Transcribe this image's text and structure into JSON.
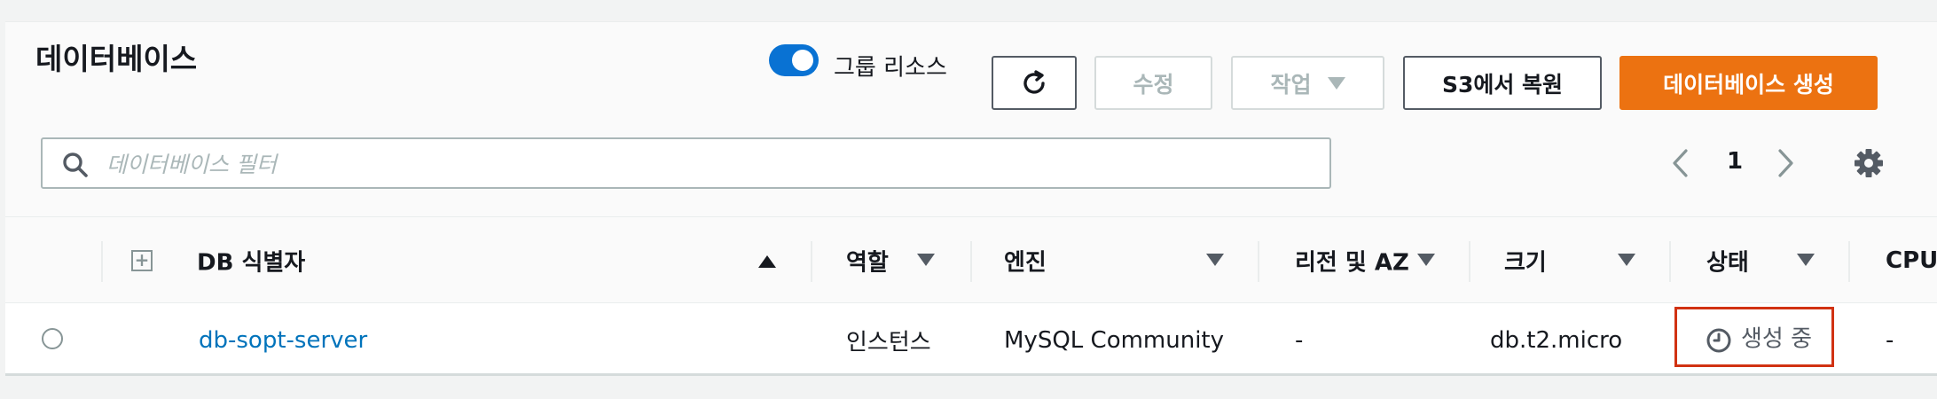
{
  "header": {
    "title": "데이터베이스",
    "group_toggle_label": "그룹 리소스",
    "edit_label": "수정",
    "actions_label": "작업",
    "restore_label": "S3에서 복원",
    "create_label": "데이터베이스 생성"
  },
  "search": {
    "placeholder": "데이터베이스 필터",
    "value": ""
  },
  "pagination": {
    "current_page": "1"
  },
  "table": {
    "columns": [
      "DB 식별자",
      "역할",
      "엔진",
      "리전 및 AZ",
      "크기",
      "상태",
      "CPU"
    ],
    "rows": [
      {
        "identifier": "db-sopt-server",
        "role": "인스턴스",
        "engine": "MySQL Community",
        "region_az": "-",
        "size": "db.t2.micro",
        "status": "생성 중",
        "cpu": "-"
      }
    ]
  },
  "colors": {
    "accent": "#0972d3",
    "primary_button": "#ec7211",
    "link": "#0073bb",
    "status_highlight": "#d13212"
  },
  "icons": [
    "refresh-icon",
    "caret-down-icon",
    "search-icon",
    "chevron-left-icon",
    "chevron-right-icon",
    "gear-icon",
    "expand-all-icon",
    "sort-ascending-icon",
    "sort-descending-icon",
    "clock-icon"
  ]
}
